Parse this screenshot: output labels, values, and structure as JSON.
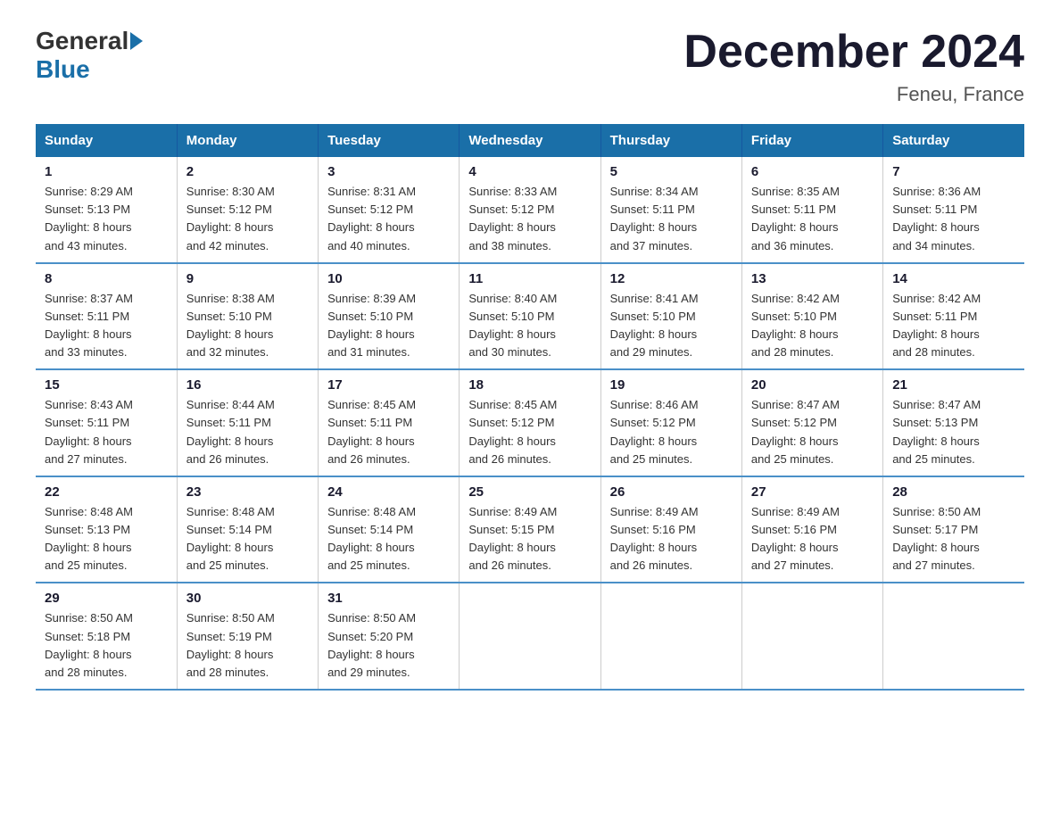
{
  "logo": {
    "general": "General",
    "blue": "Blue"
  },
  "title": "December 2024",
  "subtitle": "Feneu, France",
  "days_header": [
    "Sunday",
    "Monday",
    "Tuesday",
    "Wednesday",
    "Thursday",
    "Friday",
    "Saturday"
  ],
  "weeks": [
    [
      {
        "day": "1",
        "info": "Sunrise: 8:29 AM\nSunset: 5:13 PM\nDaylight: 8 hours\nand 43 minutes."
      },
      {
        "day": "2",
        "info": "Sunrise: 8:30 AM\nSunset: 5:12 PM\nDaylight: 8 hours\nand 42 minutes."
      },
      {
        "day": "3",
        "info": "Sunrise: 8:31 AM\nSunset: 5:12 PM\nDaylight: 8 hours\nand 40 minutes."
      },
      {
        "day": "4",
        "info": "Sunrise: 8:33 AM\nSunset: 5:12 PM\nDaylight: 8 hours\nand 38 minutes."
      },
      {
        "day": "5",
        "info": "Sunrise: 8:34 AM\nSunset: 5:11 PM\nDaylight: 8 hours\nand 37 minutes."
      },
      {
        "day": "6",
        "info": "Sunrise: 8:35 AM\nSunset: 5:11 PM\nDaylight: 8 hours\nand 36 minutes."
      },
      {
        "day": "7",
        "info": "Sunrise: 8:36 AM\nSunset: 5:11 PM\nDaylight: 8 hours\nand 34 minutes."
      }
    ],
    [
      {
        "day": "8",
        "info": "Sunrise: 8:37 AM\nSunset: 5:11 PM\nDaylight: 8 hours\nand 33 minutes."
      },
      {
        "day": "9",
        "info": "Sunrise: 8:38 AM\nSunset: 5:10 PM\nDaylight: 8 hours\nand 32 minutes."
      },
      {
        "day": "10",
        "info": "Sunrise: 8:39 AM\nSunset: 5:10 PM\nDaylight: 8 hours\nand 31 minutes."
      },
      {
        "day": "11",
        "info": "Sunrise: 8:40 AM\nSunset: 5:10 PM\nDaylight: 8 hours\nand 30 minutes."
      },
      {
        "day": "12",
        "info": "Sunrise: 8:41 AM\nSunset: 5:10 PM\nDaylight: 8 hours\nand 29 minutes."
      },
      {
        "day": "13",
        "info": "Sunrise: 8:42 AM\nSunset: 5:10 PM\nDaylight: 8 hours\nand 28 minutes."
      },
      {
        "day": "14",
        "info": "Sunrise: 8:42 AM\nSunset: 5:11 PM\nDaylight: 8 hours\nand 28 minutes."
      }
    ],
    [
      {
        "day": "15",
        "info": "Sunrise: 8:43 AM\nSunset: 5:11 PM\nDaylight: 8 hours\nand 27 minutes."
      },
      {
        "day": "16",
        "info": "Sunrise: 8:44 AM\nSunset: 5:11 PM\nDaylight: 8 hours\nand 26 minutes."
      },
      {
        "day": "17",
        "info": "Sunrise: 8:45 AM\nSunset: 5:11 PM\nDaylight: 8 hours\nand 26 minutes."
      },
      {
        "day": "18",
        "info": "Sunrise: 8:45 AM\nSunset: 5:12 PM\nDaylight: 8 hours\nand 26 minutes."
      },
      {
        "day": "19",
        "info": "Sunrise: 8:46 AM\nSunset: 5:12 PM\nDaylight: 8 hours\nand 25 minutes."
      },
      {
        "day": "20",
        "info": "Sunrise: 8:47 AM\nSunset: 5:12 PM\nDaylight: 8 hours\nand 25 minutes."
      },
      {
        "day": "21",
        "info": "Sunrise: 8:47 AM\nSunset: 5:13 PM\nDaylight: 8 hours\nand 25 minutes."
      }
    ],
    [
      {
        "day": "22",
        "info": "Sunrise: 8:48 AM\nSunset: 5:13 PM\nDaylight: 8 hours\nand 25 minutes."
      },
      {
        "day": "23",
        "info": "Sunrise: 8:48 AM\nSunset: 5:14 PM\nDaylight: 8 hours\nand 25 minutes."
      },
      {
        "day": "24",
        "info": "Sunrise: 8:48 AM\nSunset: 5:14 PM\nDaylight: 8 hours\nand 25 minutes."
      },
      {
        "day": "25",
        "info": "Sunrise: 8:49 AM\nSunset: 5:15 PM\nDaylight: 8 hours\nand 26 minutes."
      },
      {
        "day": "26",
        "info": "Sunrise: 8:49 AM\nSunset: 5:16 PM\nDaylight: 8 hours\nand 26 minutes."
      },
      {
        "day": "27",
        "info": "Sunrise: 8:49 AM\nSunset: 5:16 PM\nDaylight: 8 hours\nand 27 minutes."
      },
      {
        "day": "28",
        "info": "Sunrise: 8:50 AM\nSunset: 5:17 PM\nDaylight: 8 hours\nand 27 minutes."
      }
    ],
    [
      {
        "day": "29",
        "info": "Sunrise: 8:50 AM\nSunset: 5:18 PM\nDaylight: 8 hours\nand 28 minutes."
      },
      {
        "day": "30",
        "info": "Sunrise: 8:50 AM\nSunset: 5:19 PM\nDaylight: 8 hours\nand 28 minutes."
      },
      {
        "day": "31",
        "info": "Sunrise: 8:50 AM\nSunset: 5:20 PM\nDaylight: 8 hours\nand 29 minutes."
      },
      {
        "day": "",
        "info": ""
      },
      {
        "day": "",
        "info": ""
      },
      {
        "day": "",
        "info": ""
      },
      {
        "day": "",
        "info": ""
      }
    ]
  ]
}
